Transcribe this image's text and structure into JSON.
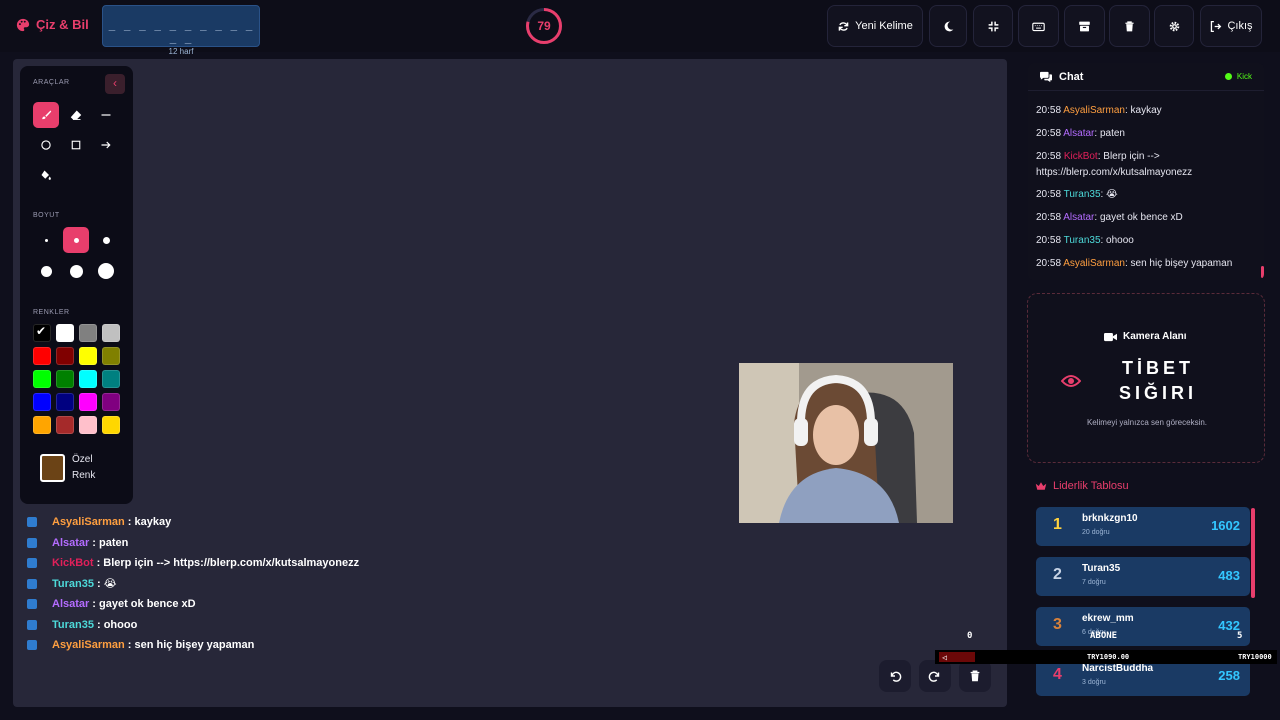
{
  "app": {
    "title": "Çiz & Bil",
    "brand_color": "#e83e6c"
  },
  "word": {
    "masked": "_ _ _ _ _ _ _ _ _ _ _ _",
    "letters": "12 harf"
  },
  "timer": {
    "value": "79",
    "progress": 0.79
  },
  "toolbar": {
    "new_word": "Yeni Kelime",
    "exit": "Çıkış",
    "icons": [
      "moon-icon",
      "compress-icon",
      "keyboard-icon",
      "archive-icon",
      "trash-icon",
      "gear-icon"
    ]
  },
  "tools_panel": {
    "section_tools": "ARAÇLAR",
    "section_size": "BOYUT",
    "section_colors": "RENKLER",
    "custom_color": "Özel\nRenk",
    "custom_color_value": "#6b4316",
    "colors": [
      "#000000",
      "#ffffff",
      "#808080",
      "#c0c0c0",
      "#ff0000",
      "#800000",
      "#ffff00",
      "#808000",
      "#00ff00",
      "#008000",
      "#00ffff",
      "#008080",
      "#0000ff",
      "#000080",
      "#ff00ff",
      "#800080",
      "#ffa500",
      "#a52a2a",
      "#ffc0cb",
      "#ffd700"
    ]
  },
  "overlay_chat": [
    {
      "user": "AsyaliSarman",
      "color": "#ff9f40",
      "text": " : kaykay"
    },
    {
      "user": "Alsatar",
      "color": "#b46cff",
      "text": " : paten"
    },
    {
      "user": "KickBot",
      "color": "#e0205a",
      "text": " : Blerp için --> https://blerp.com/x/kutsalmayonezz"
    },
    {
      "user": "Turan35",
      "color": "#4dd9d9",
      "text": " : 😭"
    },
    {
      "user": "Alsatar",
      "color": "#b46cff",
      "text": " : gayet ok bence xD"
    },
    {
      "user": "Turan35",
      "color": "#4dd9d9",
      "text": " : ohooo"
    },
    {
      "user": "AsyaliSarman",
      "color": "#ff9f40",
      "text": " : sen hiç bişey yapaman"
    }
  ],
  "chat": {
    "title": "Chat",
    "platform": "Kick",
    "messages": [
      {
        "time": "20:58",
        "user": "AsyaliSarman",
        "color": "#ff9f40",
        "text": ": kaykay"
      },
      {
        "time": "20:58",
        "user": "Alsatar",
        "color": "#b46cff",
        "text": ": paten"
      },
      {
        "time": "20:58",
        "user": "KickBot",
        "color": "#e0205a",
        "text": ": Blerp için --> https://blerp.com/x/kutsalmayonezz"
      },
      {
        "time": "20:58",
        "user": "Turan35",
        "color": "#4dd9d9",
        "text": ": 😭"
      },
      {
        "time": "20:58",
        "user": "Alsatar",
        "color": "#b46cff",
        "text": ": gayet ok bence xD"
      },
      {
        "time": "20:58",
        "user": "Turan35",
        "color": "#4dd9d9",
        "text": ": ohooo"
      },
      {
        "time": "20:58",
        "user": "AsyaliSarman",
        "color": "#ff9f40",
        "text": ": sen hiç bişey yapaman"
      }
    ]
  },
  "camera": {
    "label": "Kamera Alanı",
    "secret_line1": "TİBET",
    "secret_line2": "SIĞIRI",
    "hint": "Kelimeyi yalnızca sen göreceksin."
  },
  "leaderboard": {
    "title": "Liderlik Tablosu",
    "rows": [
      {
        "rank": "1",
        "name": "brknkzgn10",
        "sub": "20 doğru",
        "score": "1602",
        "rank_color": "#ffd23f"
      },
      {
        "rank": "2",
        "name": "Turan35",
        "sub": "7 doğru",
        "score": "483",
        "rank_color": "#c8d4e6"
      },
      {
        "rank": "3",
        "name": "ekrew_mm",
        "sub": "6 doğru",
        "score": "432",
        "rank_color": "#d9823b"
      },
      {
        "rank": "4",
        "name": "NarcistBuddha",
        "sub": "3 doğru",
        "score": "258",
        "rank_color": "#e83e6c"
      }
    ]
  },
  "goal_bar": {
    "left_count": "0",
    "label": "ABONE",
    "right_count": "5",
    "current": "TRY1090.00",
    "target": "TRY10000",
    "progress": 0.109
  }
}
